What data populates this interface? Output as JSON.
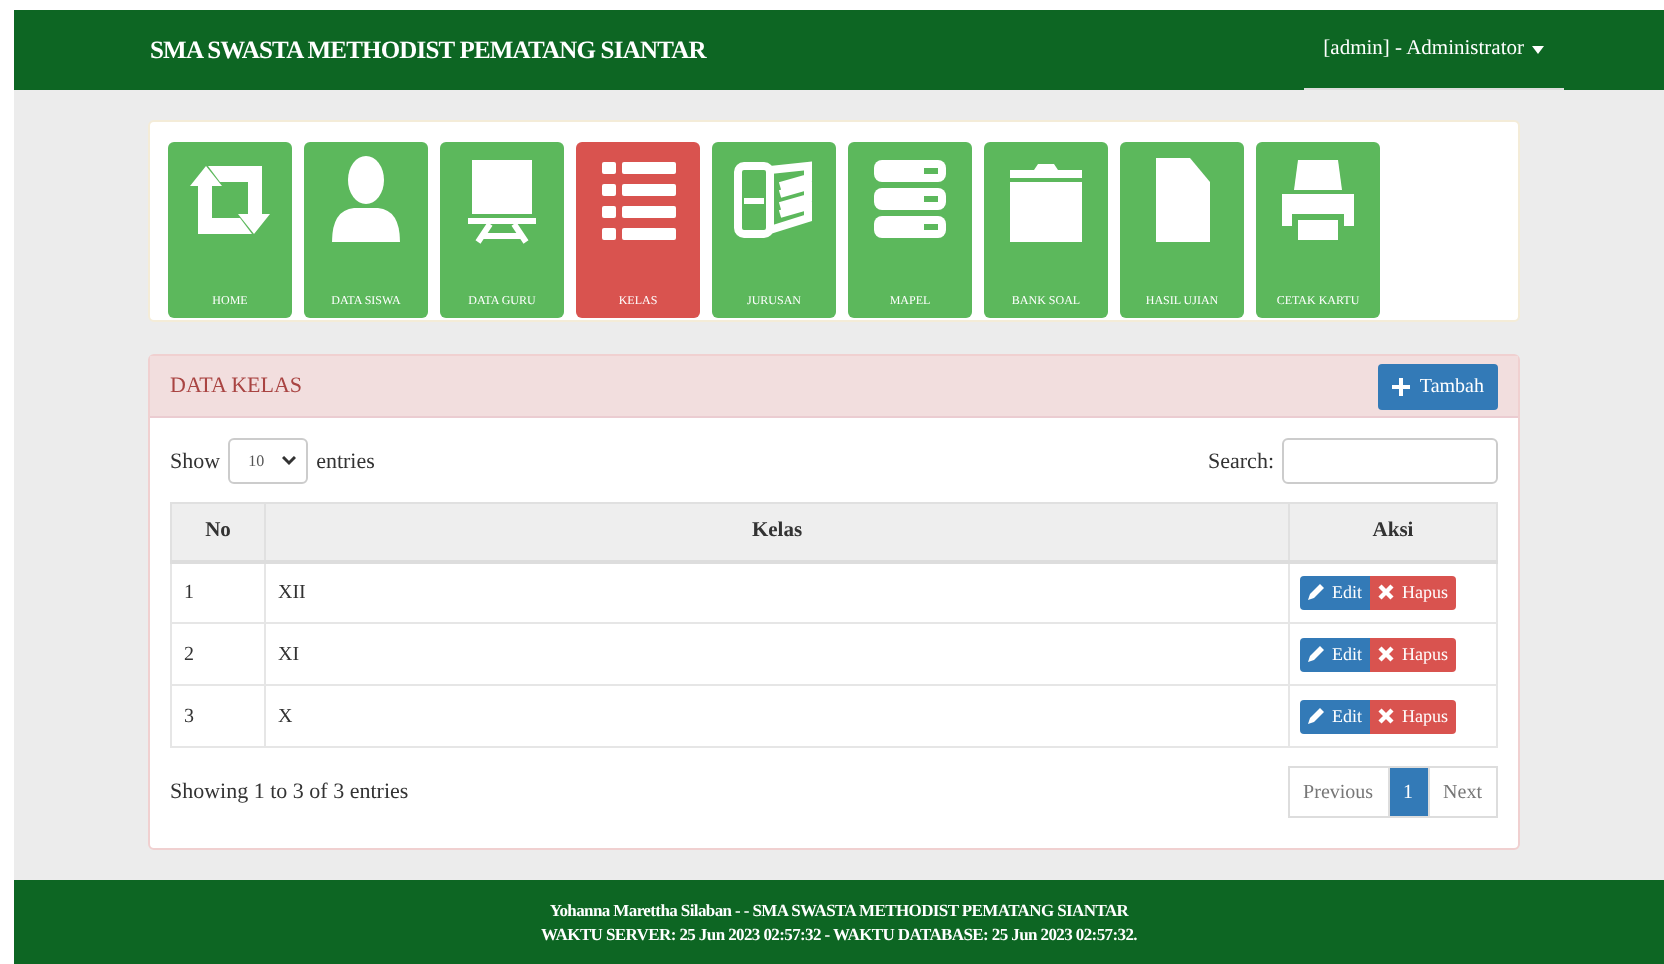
{
  "navbar": {
    "brand": "SMA SWASTA METHODIST PEMATANG SIANTAR",
    "user_menu": "[admin] - Administrator"
  },
  "menu_tiles": [
    {
      "label": "HOME",
      "selected": false
    },
    {
      "label": "DATA SISWA",
      "selected": false
    },
    {
      "label": "DATA GURU",
      "selected": false
    },
    {
      "label": "KELAS",
      "selected": true
    },
    {
      "label": "JURUSAN",
      "selected": false
    },
    {
      "label": "MAPEL",
      "selected": false
    },
    {
      "label": "BANK SOAL",
      "selected": false
    },
    {
      "label": "HASIL UJIAN",
      "selected": false
    },
    {
      "label": "CETAK KARTU",
      "selected": false
    }
  ],
  "panel": {
    "title": "DATA KELAS",
    "add_button": "Tambah",
    "length": {
      "show": "Show",
      "value": "10",
      "entries": "entries"
    },
    "search_label": "Search:",
    "table": {
      "columns": [
        "No",
        "Kelas",
        "Aksi"
      ],
      "rows": [
        {
          "no": "1",
          "kelas": "XII",
          "edit": "Edit",
          "delete": "Hapus"
        },
        {
          "no": "2",
          "kelas": "XI",
          "edit": "Edit",
          "delete": "Hapus"
        },
        {
          "no": "3",
          "kelas": "X",
          "edit": "Edit",
          "delete": "Hapus"
        }
      ]
    },
    "info": "Showing 1 to 3 of 3 entries",
    "pagination": [
      {
        "label": "Previous",
        "selected": false
      },
      {
        "label": "1",
        "selected": true
      },
      {
        "label": "Next",
        "selected": false
      }
    ]
  },
  "footer": {
    "line_1": "Yohanna Marettha Silaban - - SMA SWASTA METHODIST PEMATANG SIANTAR",
    "line_2": "WAKTU SERVER: 25 Jun 2023 02:57:32 - WAKTU DATABASE: 25 Jun 2023 02:57:32."
  }
}
